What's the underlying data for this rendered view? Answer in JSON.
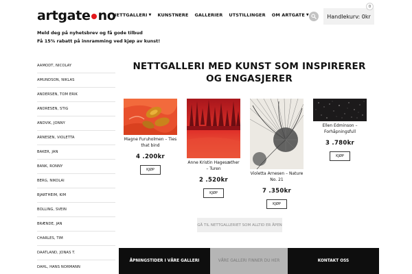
{
  "logo": {
    "part1": "artgate",
    "part2": "no"
  },
  "nav": [
    {
      "label": "NETTGALLERI",
      "has_dropdown": true
    },
    {
      "label": "KUNSTNERE",
      "has_dropdown": false
    },
    {
      "label": "GALLERIER",
      "has_dropdown": false
    },
    {
      "label": "UTSTILLINGER",
      "has_dropdown": false
    },
    {
      "label": "OM ARTGATE",
      "has_dropdown": true
    }
  ],
  "icons": {
    "search": "search-icon",
    "dropdown": "chevron-down-icon"
  },
  "cart": {
    "label": "Handlekurv: 0kr",
    "count": "0"
  },
  "newsletter": "Meld deg på nyhetsbrev og få gode tilbud",
  "promo": "Få 15% rabatt på innramming ved kjøp av kunst!",
  "artists": [
    "AAMODT, NICOLAY",
    "AMUNDSON, NIKLAS",
    "ANDERSEN, TOM ERIK",
    "ANDRESEN, STIG",
    "ANDVIK, JONNY",
    "ARNESEN, VIOLETTA",
    "BAKER, JAN",
    "BANK, RONNY",
    "BERG, NIKOLAI",
    "BJARTHEIM, KIM",
    "BOLLING, SVEIN",
    "BRÆNDE, JAN",
    "CHARLES, TIM",
    "DAATLAND, JONAS T.",
    "DAHL, HANS NORMANN"
  ],
  "headline": "NETTGALLERI MED KUNST SOM INSPIRERER OG ENGASJERER",
  "products": [
    {
      "caption": "Magne Furuholmen – Ties that bind",
      "price": "4 .200kr",
      "buy_label": "KJØP"
    },
    {
      "caption": "Anne Kristin Hagesæther – Turen",
      "price": "2 .520kr",
      "buy_label": "KJØP"
    },
    {
      "caption": "Violetta Arnesen – Nature No. 21",
      "price": "7 .350kr",
      "buy_label": "KJØP"
    },
    {
      "caption": "Ellen Edminson – Forhåpningsfull",
      "price": "3 .780kr",
      "buy_label": "KJØP"
    }
  ],
  "cta": "GÅ TIL NETTGALLERIET SOM ALLTID ER ÅPEN",
  "footer": {
    "tile1": "ÅPNINGSTIDER I VÅRE GALLERI",
    "tile2": "VÅRE GALLERI FINNER DU HER",
    "tile3": "KONTAKT OSS"
  },
  "colors": {
    "accent": "#e3171b",
    "dark": "#0e0e0e",
    "muted": "#b5b5b5"
  }
}
